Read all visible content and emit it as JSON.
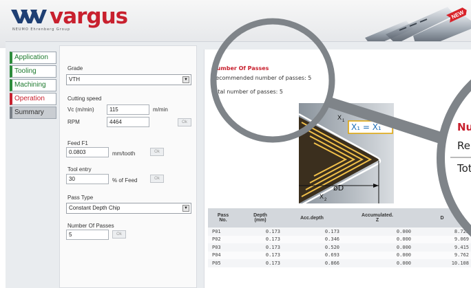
{
  "header": {
    "logo_text": "vargus",
    "logo_sub": "NEUMO Ehrenberg Group",
    "new_badge": "NEW"
  },
  "tabs": [
    {
      "label": "Application",
      "state": "done"
    },
    {
      "label": "Tooling",
      "state": "done"
    },
    {
      "label": "Machining",
      "state": "done"
    },
    {
      "label": "Operation",
      "state": "active"
    },
    {
      "label": "Summary",
      "state": "disabled"
    }
  ],
  "form": {
    "grade_label": "Grade",
    "grade_value": "VTH",
    "cutting_speed_label": "Cutting speed",
    "vc_label": "Vc (m/min)",
    "vc_value": "115",
    "vc_unit": "m/min",
    "rpm_label": "RPM",
    "rpm_value": "4464",
    "ok": "Ok",
    "feed_label": "Feed F1",
    "feed_value": "0.0803",
    "feed_unit": "mm/tooth",
    "tool_entry_label": "Tool entry",
    "tool_entry_value": "30",
    "tool_entry_unit": "% of Feed",
    "pass_type_label": "Pass Type",
    "pass_type_value": "Constant Depth Chip",
    "num_passes_label": "Number Of Passes",
    "num_passes_value": "5"
  },
  "result": {
    "title": "Number Of Passes",
    "recommended": "Recommended number of passes: 5",
    "total": "Total number of passes: 5"
  },
  "magnifier": {
    "title_fragment": "Nu",
    "recommended_fragment": "Re",
    "total_fragment": "Tot"
  },
  "diagram": {
    "x1_label": "X",
    "x1_sub": "1",
    "eq_label": "X₁ = X₁",
    "x2_label": "X",
    "x2_sub": "2",
    "diameter_label": "øD"
  },
  "table": {
    "headers": [
      "Pass\nNo.",
      "Depth\n(mm)",
      "Acc.depth",
      "Accumulated.\nZ",
      "D"
    ],
    "rows": [
      [
        "P01",
        "0.173",
        "0.173",
        "0.000",
        "8.723"
      ],
      [
        "P02",
        "0.173",
        "0.346",
        "0.000",
        "9.069"
      ],
      [
        "P03",
        "0.173",
        "0.520",
        "0.000",
        "9.415"
      ],
      [
        "P04",
        "0.173",
        "0.693",
        "0.000",
        "9.762"
      ],
      [
        "P05",
        "0.173",
        "0.866",
        "0.000",
        "10.108"
      ]
    ]
  },
  "colors": {
    "brand_red": "#c8202e",
    "tab_green": "#1d7a2e",
    "badge_red": "#d8232a"
  }
}
